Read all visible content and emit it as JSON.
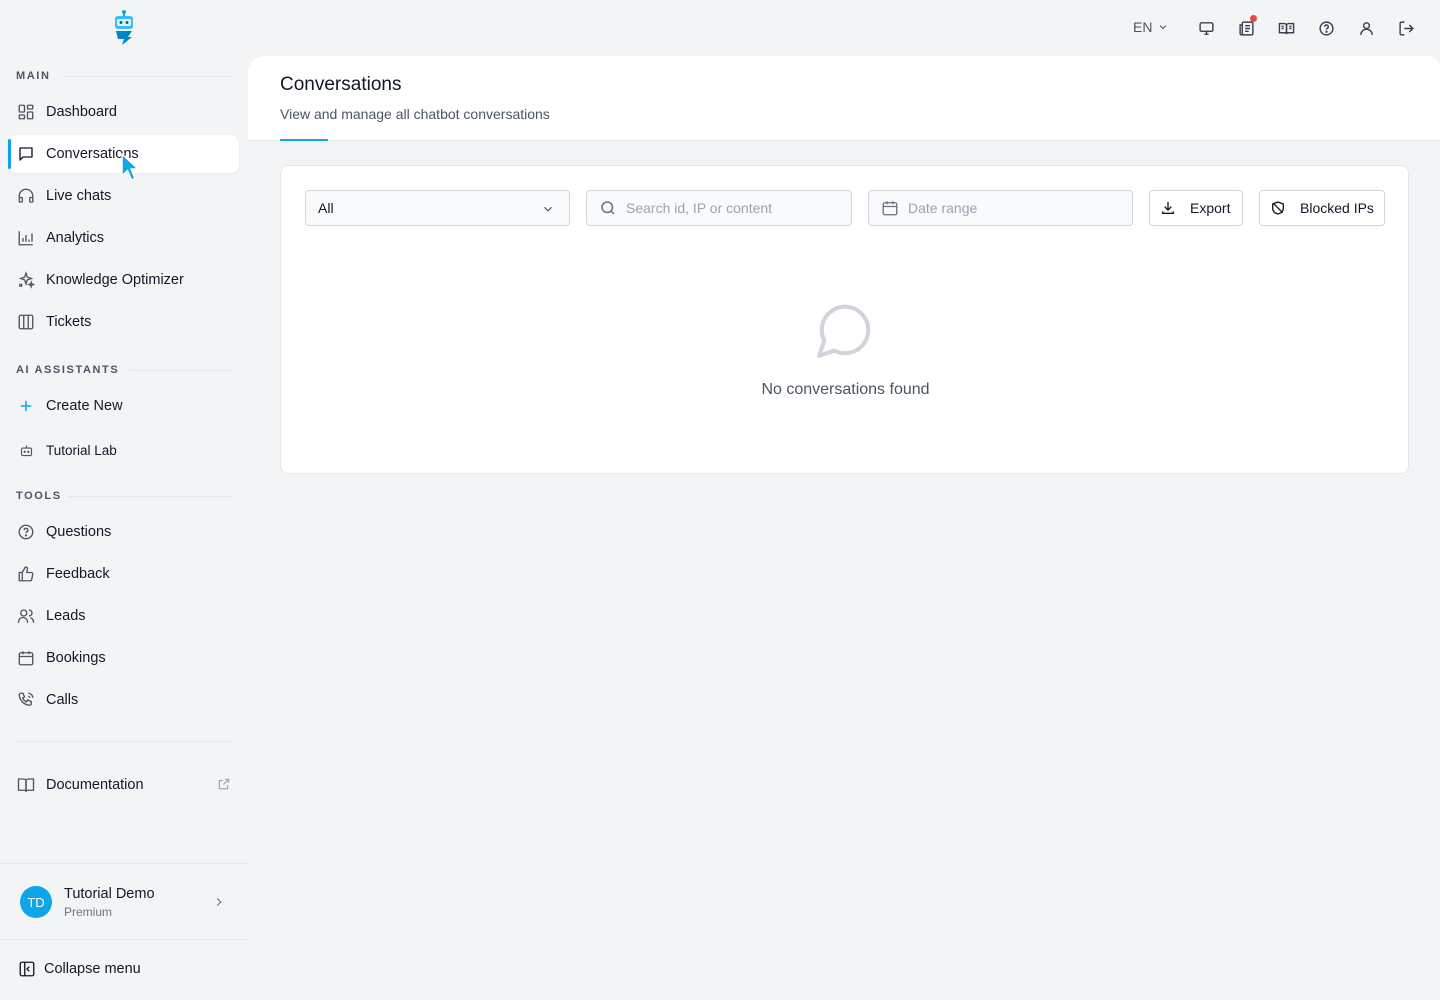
{
  "topbar": {
    "language": "EN",
    "icons": [
      "monitor-icon",
      "news-icon",
      "book-open-icon",
      "help-icon",
      "user-icon",
      "logout-icon"
    ]
  },
  "sidebar": {
    "sections": {
      "main": "MAIN",
      "ai_assistants": "AI ASSISTANTS",
      "tools": "TOOLS"
    },
    "main_items": [
      {
        "label": "Dashboard",
        "icon": "dashboard-icon"
      },
      {
        "label": "Conversations",
        "icon": "chat-icon",
        "active": true
      },
      {
        "label": "Live chats",
        "icon": "headphones-icon"
      },
      {
        "label": "Analytics",
        "icon": "bar-chart-icon"
      },
      {
        "label": "Knowledge Optimizer",
        "icon": "sparkles-icon"
      },
      {
        "label": "Tickets",
        "icon": "columns-icon"
      }
    ],
    "assistant_items": [
      {
        "label": "Create New",
        "icon": "plus-icon"
      },
      {
        "label": "Tutorial Lab",
        "icon": "bot-icon"
      }
    ],
    "tool_items": [
      {
        "label": "Questions",
        "icon": "question-icon"
      },
      {
        "label": "Feedback",
        "icon": "thumbs-up-icon"
      },
      {
        "label": "Leads",
        "icon": "users-icon"
      },
      {
        "label": "Bookings",
        "icon": "calendar-icon"
      },
      {
        "label": "Calls",
        "icon": "phone-icon"
      }
    ],
    "documentation": "Documentation",
    "user": {
      "initials": "TD",
      "name": "Tutorial Demo",
      "plan": "Premium"
    },
    "collapse": "Collapse menu"
  },
  "page": {
    "title": "Conversations",
    "subtitle": "View and manage all chatbot conversations"
  },
  "filters": {
    "status_selected": "All",
    "search_placeholder": "Search id, IP or content",
    "date_placeholder": "Date range",
    "export_label": "Export",
    "blocked_label": "Blocked IPs"
  },
  "empty_state": {
    "message": "No conversations found"
  },
  "colors": {
    "accent": "#0ea5e9",
    "background": "#f3f4f6",
    "notification": "#ef4444"
  }
}
